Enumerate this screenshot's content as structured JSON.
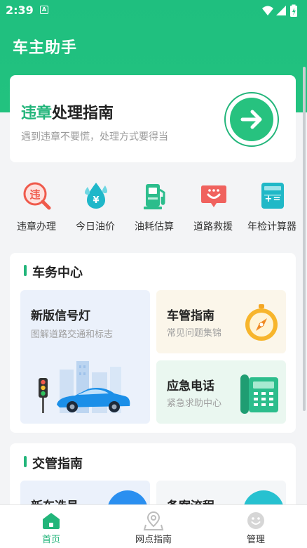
{
  "status_bar": {
    "time": "2:39",
    "notification_glyph": "A"
  },
  "app": {
    "title": "车主助手"
  },
  "hero": {
    "title_highlight": "违章",
    "title_rest": "处理指南",
    "subtitle": "遇到违章不要慌，处理方式要得当",
    "accent": "#22b57a"
  },
  "quick_actions": [
    {
      "label": "违章办理",
      "icon": "violation-search-icon"
    },
    {
      "label": "今日油价",
      "icon": "fuel-drop-icon"
    },
    {
      "label": "油耗估算",
      "icon": "fuel-pump-icon"
    },
    {
      "label": "道路救援",
      "icon": "rescue-chat-icon"
    },
    {
      "label": "年检计算器",
      "icon": "calculator-icon"
    }
  ],
  "section_affairs": {
    "title": "车务中心",
    "tiles": [
      {
        "title": "新版信号灯",
        "subtitle": "图解道路交通和标志",
        "icon": "traffic-car-illustration"
      },
      {
        "title": "车管指南",
        "subtitle": "常见问题集锦",
        "icon": "compass-icon"
      },
      {
        "title": "应急电话",
        "subtitle": "紧急求助中心",
        "icon": "telephone-icon"
      }
    ]
  },
  "section_traffic": {
    "title": "交管指南",
    "tiles": [
      {
        "title": "新车选号"
      },
      {
        "title": "备案流程"
      }
    ]
  },
  "bottom_nav": [
    {
      "label": "首页",
      "icon": "home-icon",
      "active": true
    },
    {
      "label": "网点指南",
      "icon": "location-pin-icon",
      "active": false
    },
    {
      "label": "管理",
      "icon": "smiley-icon",
      "active": false
    }
  ]
}
